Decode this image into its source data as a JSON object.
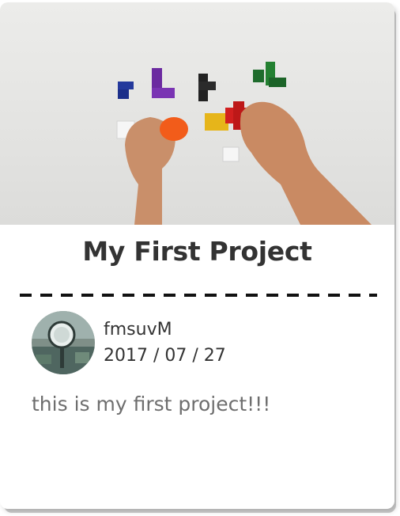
{
  "project": {
    "title": "My First Project",
    "author": "fmsuvM",
    "date": "2017 / 07 / 27",
    "description": "this is my first project!!!"
  },
  "icons": {
    "thumbnail": "project-photo",
    "avatar": "user-avatar"
  },
  "colors": {
    "title_text": "#333333",
    "description_text": "#6e6e6e",
    "divider": "#111111"
  }
}
